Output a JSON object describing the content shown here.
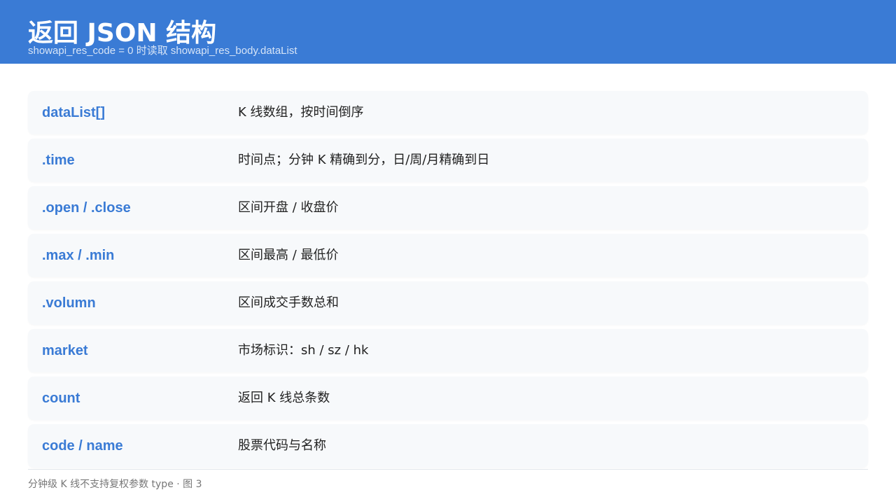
{
  "header": {
    "title": "返回 JSON 结构",
    "subtitle": "showapi_res_code = 0 时读取 showapi_res_body.dataList"
  },
  "rows": [
    {
      "field": "dataList[]",
      "desc": "K 线数组，按时间倒序"
    },
    {
      "field": ".time",
      "desc": "时间点；分钟 K 精确到分，日/周/月精确到日"
    },
    {
      "field": ".open / .close",
      "desc": "区间开盘 / 收盘价"
    },
    {
      "field": ".max / .min",
      "desc": "区间最高 / 最低价"
    },
    {
      "field": ".volumn",
      "desc": "区间成交手数总和"
    },
    {
      "field": "market",
      "desc": "市场标识：sh / sz / hk"
    },
    {
      "field": "count",
      "desc": "返回 K 线总条数"
    },
    {
      "field": "code / name",
      "desc": "股票代码与名称"
    }
  ],
  "footer": {
    "note": "分钟级 K 线不支持复权参数 type · 图 3"
  },
  "colors": {
    "header_bg": "#3a7bd5",
    "field_text": "#3a7bd5",
    "row_bg": "#f7f9fb"
  }
}
